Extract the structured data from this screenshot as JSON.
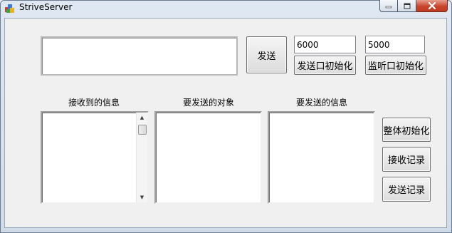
{
  "window": {
    "title": "StriveServer"
  },
  "controls": {
    "message_input_value": "",
    "send_button": "发送",
    "send_port_value": "6000",
    "listen_port_value": "5000",
    "init_send_port_button": "发送口初始化",
    "init_listen_port_button": "监听口初始化"
  },
  "lists": {
    "received_label": "接收到的信息",
    "target_label": "要发送的对象",
    "to_send_label": "要发送的信息"
  },
  "actions": {
    "init_all_button": "整体初始化",
    "receive_log_button": "接收记录",
    "send_log_button": "发送记录"
  }
}
